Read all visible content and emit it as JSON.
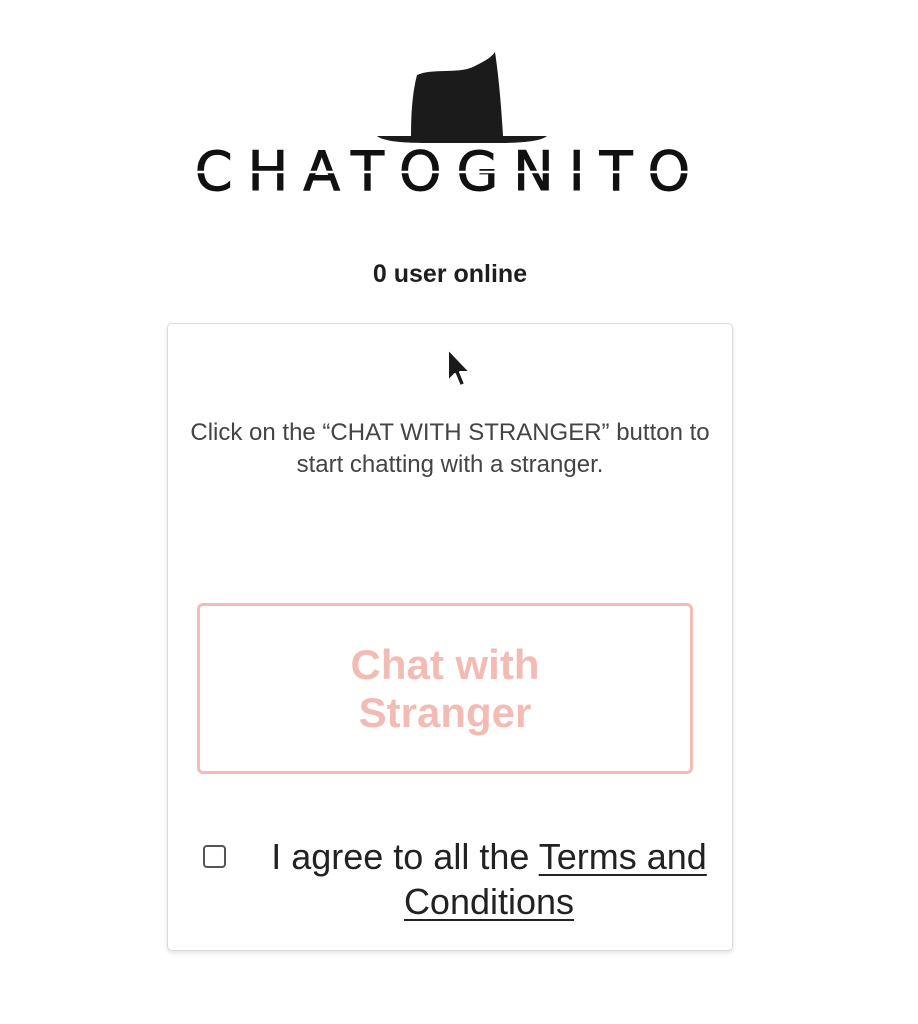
{
  "brand": {
    "name": "CHATOGNITO"
  },
  "status": {
    "online_text": "0 user online"
  },
  "card": {
    "instructions": "Click on the “CHAT WITH STRANGER” button to start chatting with a stranger.",
    "chat_button_label": "Chat with Stranger",
    "agree_prefix": "I agree to all the ",
    "terms_link_label": "Terms and Conditions"
  },
  "colors": {
    "button_accent": "#f3bdb6",
    "text_dark": "#222222",
    "card_border": "#dcdcdc"
  },
  "icons": {
    "logo": "hat-logo-icon",
    "cursor": "mouse-pointer-icon",
    "checkbox": "checkbox-unchecked"
  }
}
